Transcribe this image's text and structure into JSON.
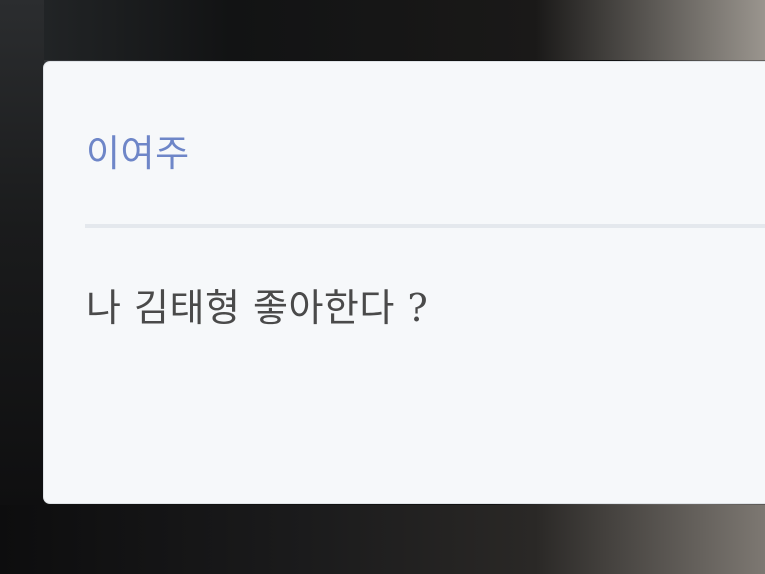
{
  "dialogue": {
    "speaker_name": "이여주",
    "message": "나 김태형 좋아한다 ?"
  },
  "colors": {
    "card_background": "#f6f8fa",
    "speaker_name": "#6e86c8",
    "message_text": "#4a4a4a",
    "divider": "#e4e8ed"
  }
}
